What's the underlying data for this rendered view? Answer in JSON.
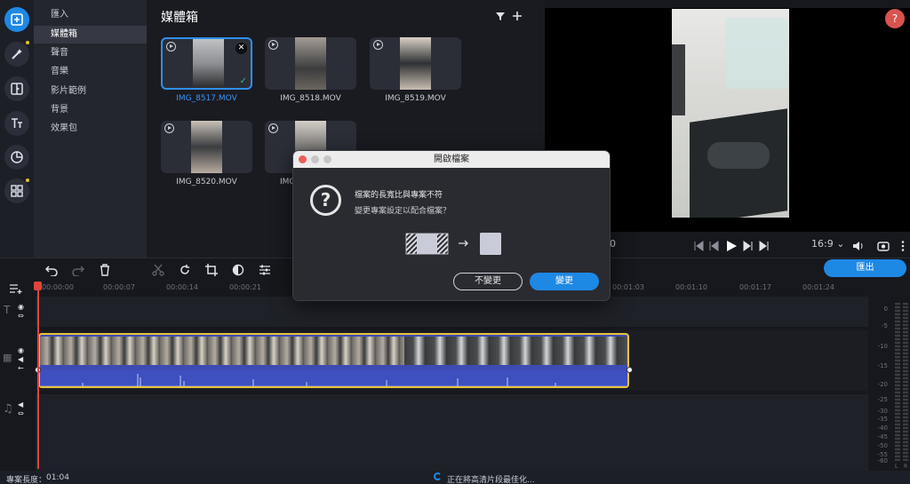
{
  "rail": {
    "icons": [
      "import-icon",
      "magic-wand-icon",
      "transitions-icon",
      "titles-icon",
      "stickers-icon",
      "more-tools-icon"
    ]
  },
  "categories": [
    "匯入",
    "媒體箱",
    "聲音",
    "音樂",
    "影片範例",
    "背景",
    "效果包"
  ],
  "media_bin": {
    "title": "媒體箱",
    "items": [
      {
        "name": "IMG_8517.MOV",
        "selected": true
      },
      {
        "name": "IMG_8518.MOV",
        "selected": false
      },
      {
        "name": "IMG_8519.MOV",
        "selected": false
      },
      {
        "name": "IMG_8520.MOV",
        "selected": false
      },
      {
        "name": "IMG_8521.MOV",
        "selected": false
      }
    ],
    "item5_partial_label": "IMG"
  },
  "preview": {
    "time_fragment": "0",
    "aspect_ratio": "16:9",
    "help_label": "?"
  },
  "toolbar": {
    "export_label": "匯出"
  },
  "ruler": {
    "ticks": [
      "00:00:00",
      "00:00:07",
      "00:00:14",
      "00:00:21",
      "00:01:03",
      "00:01:10",
      "00:01:17",
      "00:01:24"
    ]
  },
  "meter": {
    "labels": [
      "0",
      "-5",
      "-10",
      "-15",
      "-20",
      "-25",
      "-30",
      "-35",
      "-40",
      "-45",
      "-50",
      "-55",
      "-60"
    ],
    "channels": [
      "L",
      "R"
    ]
  },
  "status": {
    "project_length_label": "專案長度：",
    "project_length": "01:04",
    "progress_text": "正在將高清片段最佳化..."
  },
  "dialog": {
    "title": "開啟檔案",
    "heading": "檔案的長寬比與專案不符",
    "question": "變更專案設定以配合檔案？",
    "cancel_label": "不變更",
    "confirm_label": "變更"
  },
  "colors": {
    "accent": "#1e88e5",
    "playhead": "#e0443a",
    "clip_border": "#e8c33a",
    "audio": "#3e4fbf"
  }
}
